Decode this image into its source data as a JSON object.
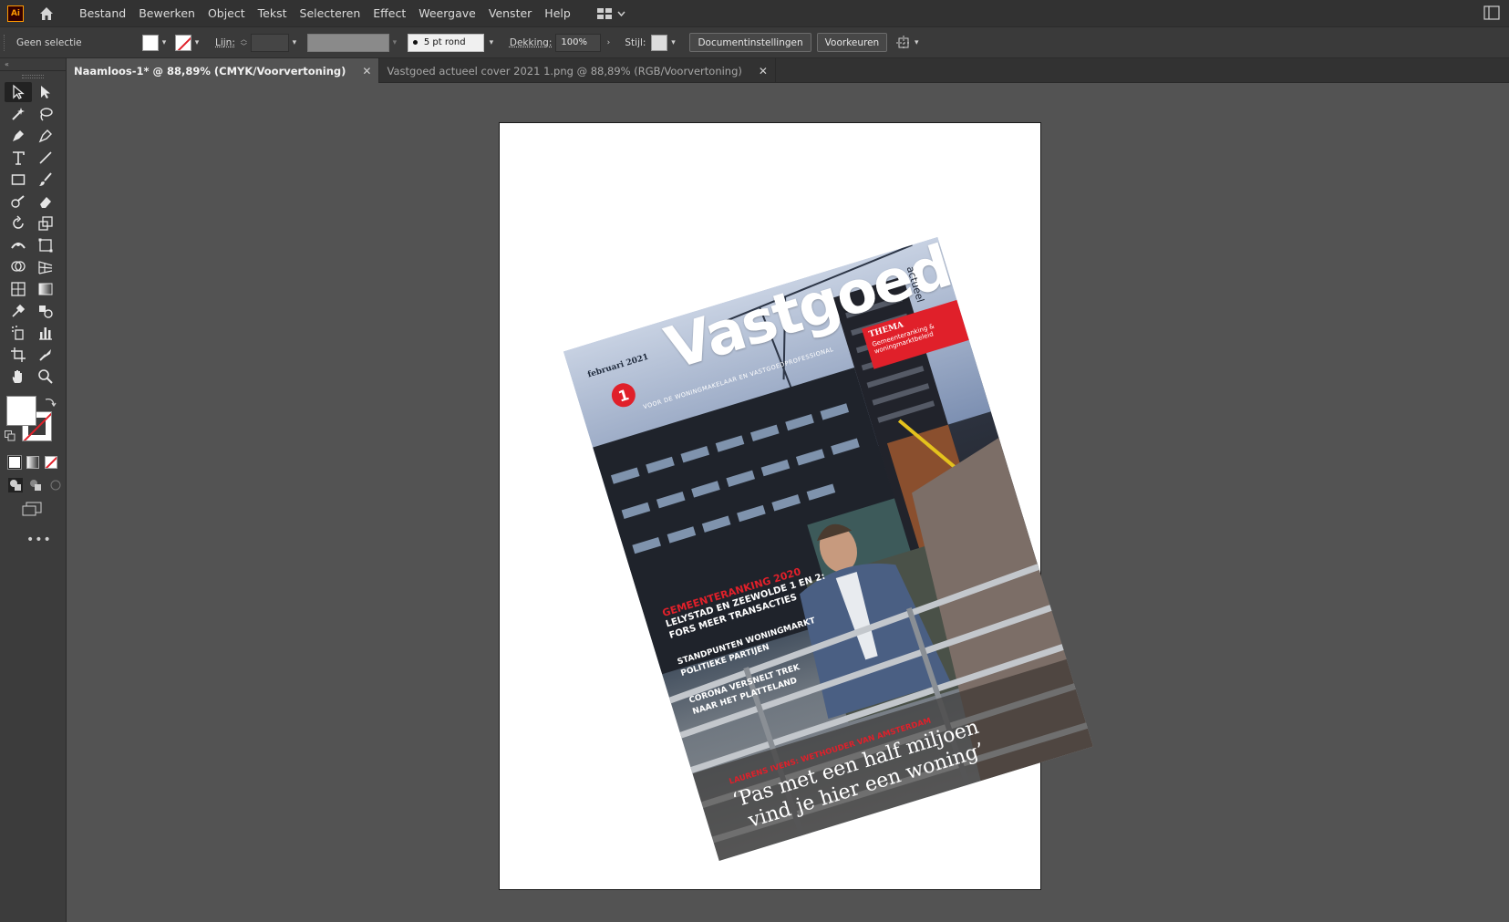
{
  "app": {
    "logo": "Ai"
  },
  "menu": [
    "Bestand",
    "Bewerken",
    "Object",
    "Tekst",
    "Selecteren",
    "Effect",
    "Weergave",
    "Venster",
    "Help"
  ],
  "control": {
    "selection": "Geen selectie",
    "stroke_label": "Lijn:",
    "brush": "5 pt rond",
    "opacity_label": "Dekking:",
    "opacity_value": "100%",
    "style_label": "Stijl:",
    "doc_settings": "Documentinstellingen",
    "preferences": "Voorkeuren"
  },
  "tabs": [
    {
      "label": "Naamloos-1* @ 88,89% (CMYK/Voorvertoning)",
      "active": true
    },
    {
      "label": "Vastgoed actueel cover 2021 1.png @ 88,89% (RGB/Voorvertoning)",
      "active": false
    }
  ],
  "cover": {
    "masthead": "Vastgoed",
    "masthead_side": "actueel",
    "date": "februari 2021",
    "issue": "1",
    "thema_title": "THEMA",
    "thema_text1": "Gemeenteranking &",
    "thema_text2": "woningmarktbeleid",
    "tagline": "VOOR DE WONINGMAKELAAR EN VASTGOEDPROFESSIONAL",
    "headline_red": "GEMEENTERANKING 2020",
    "headline1": "LELYSTAD EN ZEEWOLDE 1 EN 2:",
    "headline2": "FORS MEER TRANSACTIES",
    "story2_a": "STANDPUNTEN WONINGMARKT",
    "story2_b": "POLITIEKE PARTIJEN",
    "story3_a": "CORONA VERSNELT TREK",
    "story3_b": "NAAR HET PLATTELAND",
    "quote_credit": "LAURENS IVENS: WETHOUDER VAN AMSTERDAM",
    "quote1": "‘Pas met een half miljoen",
    "quote2": "vind je hier een woning’"
  },
  "colors": {
    "accent_red": "#e0202a",
    "canvas": "#535353",
    "chrome": "#323232"
  }
}
